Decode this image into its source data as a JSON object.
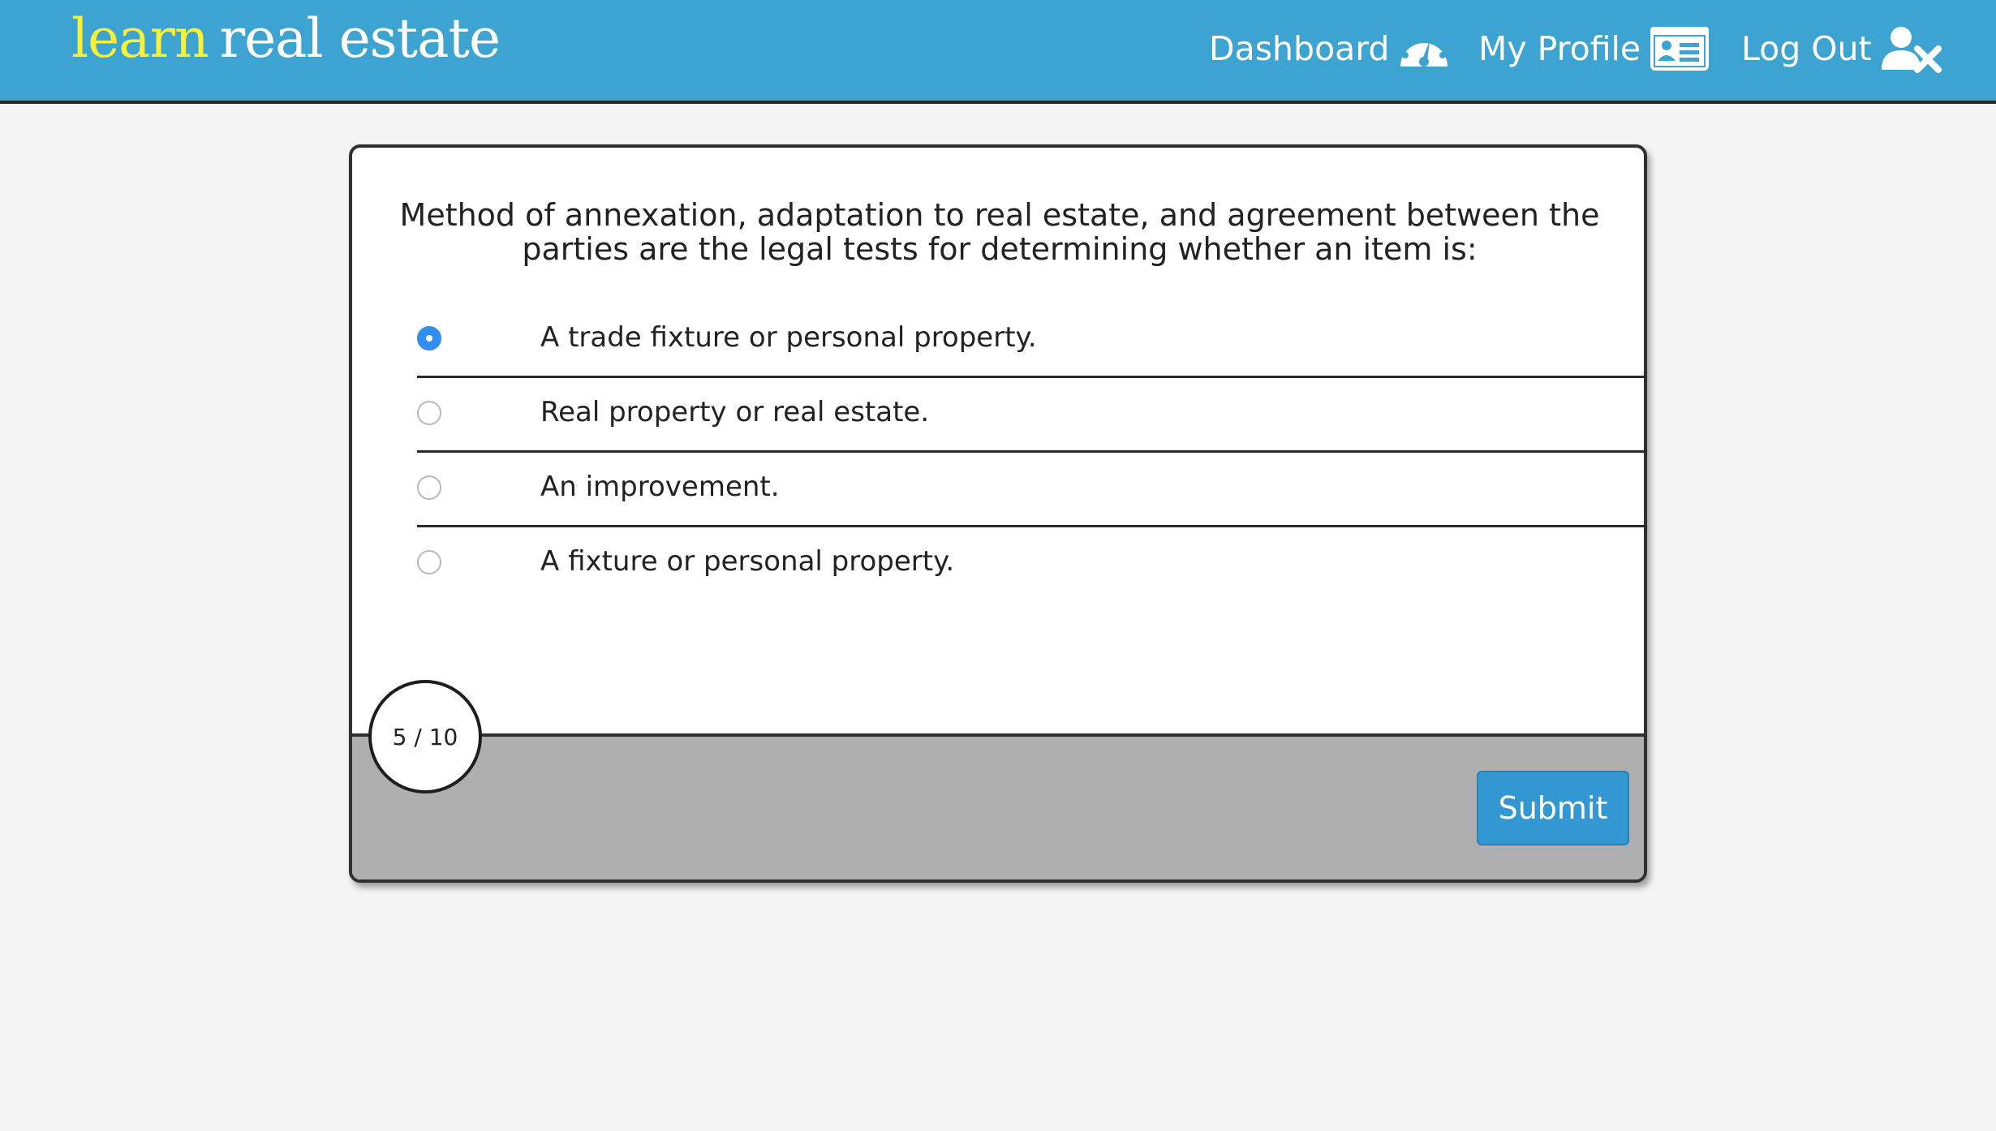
{
  "header": {
    "logo_learn": "learn",
    "logo_rest": "real estate",
    "nav": {
      "dashboard": "Dashboard",
      "profile": "My Profile",
      "logout": "Log Out"
    }
  },
  "quiz": {
    "question": "Method of annexation, adaptation to real estate, and agreement between the parties are the legal tests for determining whether an item is:",
    "options": [
      {
        "label": "A trade fixture or personal property.",
        "selected": true
      },
      {
        "label": "Real property or real estate.",
        "selected": false
      },
      {
        "label": "An improvement.",
        "selected": false
      },
      {
        "label": "A fixture or personal property.",
        "selected": false
      }
    ],
    "progress": "5 / 10",
    "submit_label": "Submit"
  },
  "colors": {
    "header_bg": "#3da3d1",
    "logo_accent": "#f7f13a",
    "radio_selected": "#2f8ef0",
    "submit_bg": "#3398d2",
    "footer_bg": "#afafaf"
  },
  "icons": {
    "dashboard": "dashboard-gauge-icon",
    "profile": "id-card-icon",
    "logout": "user-x-icon"
  }
}
